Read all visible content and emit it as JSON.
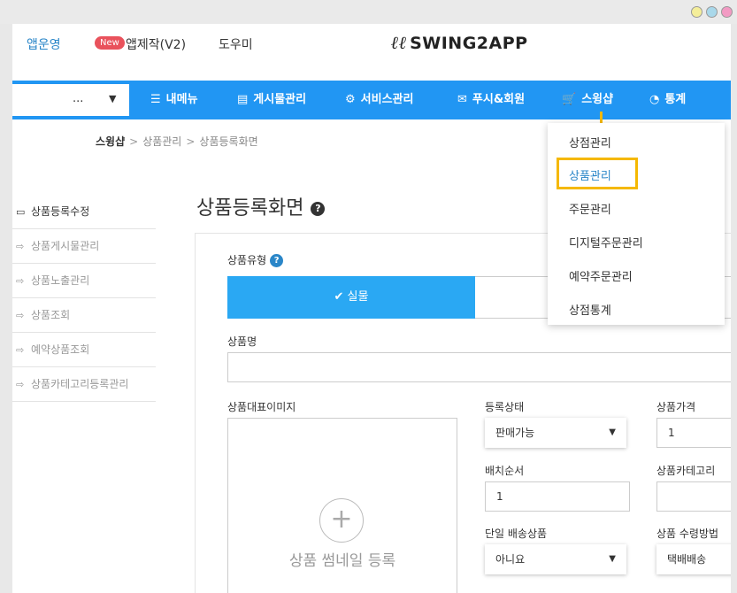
{
  "topbar": {
    "app_manage": "앱운영",
    "new_badge": "New",
    "app_make": "앱제작(V2)",
    "help": "도우미",
    "logo_mark": "ℓℓ",
    "logo_text": "SWING2APP"
  },
  "nav": {
    "app_select_value": "...",
    "items": [
      {
        "icon": "☰",
        "label": "내메뉴"
      },
      {
        "icon": "▤",
        "label": "게시물관리"
      },
      {
        "icon": "⚙",
        "label": "서비스관리"
      },
      {
        "icon": "✉",
        "label": "푸시&회원"
      },
      {
        "icon": "🛒",
        "label": "스윙샵"
      },
      {
        "icon": "◔",
        "label": "통계"
      }
    ]
  },
  "breadcrumb": [
    "스윙샵",
    "상품관리",
    "상품등록화면"
  ],
  "breadcrumb_sep": ">",
  "sidebar": {
    "items": [
      {
        "icon": "▭",
        "label": "상품등록수정"
      },
      {
        "icon": "⇨",
        "label": "상품게시물관리"
      },
      {
        "icon": "⇨",
        "label": "상품노출관리"
      },
      {
        "icon": "⇨",
        "label": "상품조회"
      },
      {
        "icon": "⇨",
        "label": "예약상품조회"
      },
      {
        "icon": "⇨",
        "label": "상품카테고리등록관리"
      }
    ]
  },
  "page": {
    "title": "상품등록화면",
    "help_icon": "?"
  },
  "form": {
    "type_label": "상품유형",
    "type_help": "?",
    "type_selected": "✔ 실물",
    "name_label": "상품명",
    "image_label": "상품대표이미지",
    "image_plus": "+",
    "image_placeholder": "상품 썸네일 등록",
    "status_label": "등록상태",
    "status_value": "판매가능",
    "price_label": "상품가격",
    "price_value": "1",
    "order_label": "배치순서",
    "order_value": "1",
    "category_label": "상품카테고리",
    "single_ship_label": "단일 배송상품",
    "single_ship_value": "아니요",
    "receive_label": "상품 수령방법",
    "receive_value": "택배배송",
    "caret": "▼"
  },
  "dropdown": {
    "items": [
      "상점관리",
      "상품관리",
      "주문관리",
      "디지털주문관리",
      "예약주문관리",
      "상점통계"
    ]
  },
  "colors": {
    "nav_bg": "#2196f3",
    "type_selected_bg": "#2aa8f3",
    "highlight": "#f5b800",
    "new_badge": "#e9525c",
    "link": "#2a86c8"
  }
}
